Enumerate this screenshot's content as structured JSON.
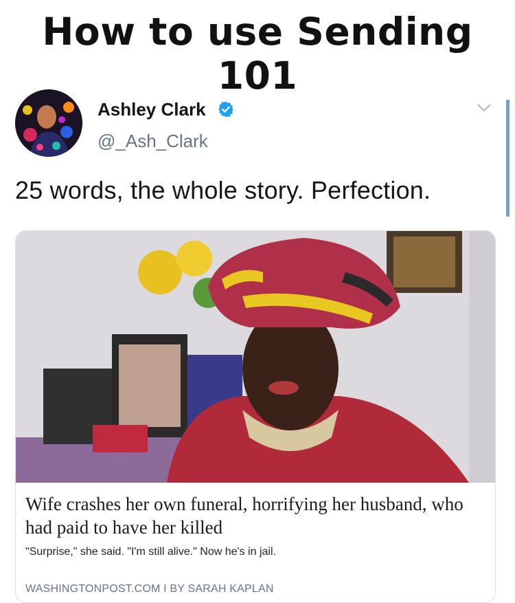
{
  "meme": {
    "title": "How to use Sending 101"
  },
  "tweet": {
    "display_name": "Ashley Clark",
    "handle": "@_Ash_Clark",
    "text": "25 words, the whole story. Perfection.",
    "verified": true
  },
  "card": {
    "headline": "Wife crashes her own funeral, horrifying her husband, who had paid to have her killed",
    "description": "\"Surprise,\" she said. \"I'm still alive.\" Now he's in jail.",
    "source": "WASHINGTONPOST.COM I BY SARAH KAPLAN"
  },
  "icons": {
    "verified": "verified-badge-icon",
    "menu": "chevron-down-icon"
  },
  "colors": {
    "verified_blue": "#1da1f2",
    "handle_gray": "#657786",
    "text": "#14171a"
  }
}
